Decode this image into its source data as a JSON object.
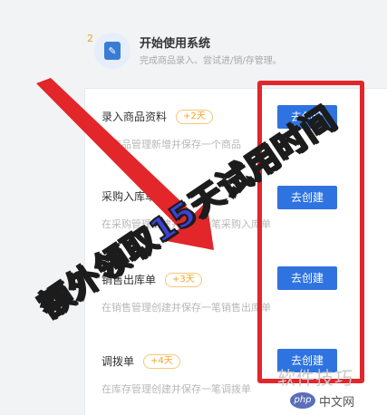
{
  "step": {
    "number": "2",
    "title": "开始使用系统",
    "description": "完成商品录入、尝试进/销/存管理。"
  },
  "tasks": [
    {
      "title": "录入商品资料",
      "days": "+2天",
      "description": "在商品管理新增并保存一个商品",
      "button": "去创建"
    },
    {
      "title": "采购入库单",
      "days": "",
      "description": "在采购管理创建并保存一笔采购入库单",
      "button": "去创建"
    },
    {
      "title": "销售出库单",
      "days": "+3天",
      "description": "在销售管理创建并保存一笔销售出库单",
      "button": "去创建"
    },
    {
      "title": "调拨单",
      "days": "+4天",
      "description": "在库存管理创建并保存一笔调拨单",
      "button": "去创建"
    }
  ],
  "overlay": {
    "text": "额外领取15天试用时间"
  },
  "watermarks": {
    "site": "软件技巧",
    "logo": "php",
    "sub": "中文网"
  },
  "colors": {
    "accent": "#2f73e0",
    "highlight": "#e2262a",
    "overlay": "#3b44d6",
    "badge": "#f5a524"
  }
}
